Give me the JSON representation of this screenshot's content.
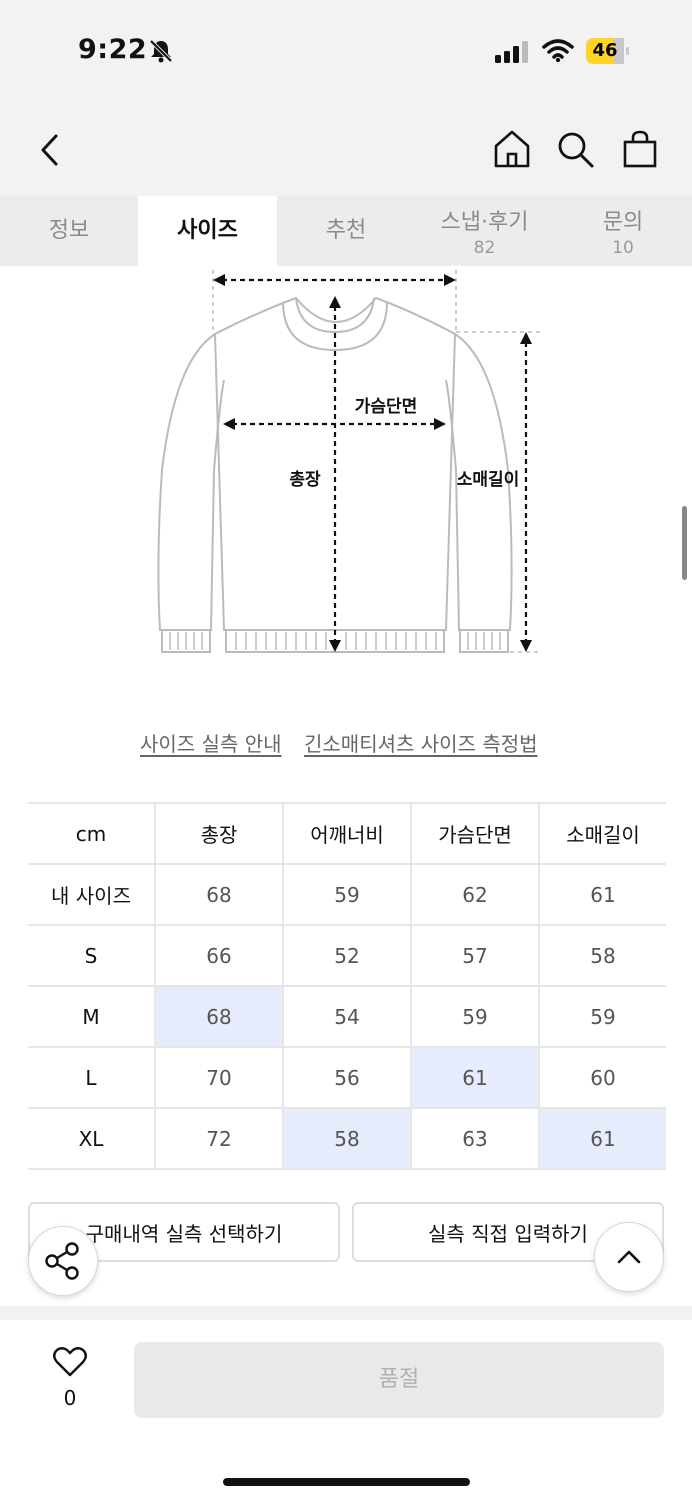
{
  "status": {
    "time": "9:22",
    "battery": "46"
  },
  "tabs": [
    {
      "label": "정보",
      "count": ""
    },
    {
      "label": "사이즈",
      "count": ""
    },
    {
      "label": "추천",
      "count": ""
    },
    {
      "label": "스냅·후기",
      "count": "82"
    },
    {
      "label": "문의",
      "count": "10"
    }
  ],
  "active_tab": "사이즈",
  "diagram": {
    "chest_label": "가슴단면",
    "length_label": "총장",
    "sleeve_label": "소매길이"
  },
  "links": {
    "guide": "사이즈 실측 안내",
    "method": "긴소매티셔츠 사이즈 측정법"
  },
  "size_table": {
    "headers": [
      "cm",
      "총장",
      "어깨너비",
      "가슴단면",
      "소매길이"
    ],
    "rows": [
      [
        "내 사이즈",
        "68",
        "59",
        "62",
        "61"
      ],
      [
        "S",
        "66",
        "52",
        "57",
        "58"
      ],
      [
        "M",
        "68",
        "54",
        "59",
        "59"
      ],
      [
        "L",
        "70",
        "56",
        "61",
        "60"
      ],
      [
        "XL",
        "72",
        "58",
        "63",
        "61"
      ]
    ],
    "highlight_color": "#e6ecfc"
  },
  "buttons": {
    "purchase_history": "구매내역 실측 선택하기",
    "manual_input": "실측 직접 입력하기"
  },
  "bottom": {
    "like_count": "0",
    "buy_label": "품절"
  },
  "icons": [
    "back-icon",
    "home-icon",
    "search-icon",
    "shopping-bag-icon",
    "share-icon",
    "chevron-up-icon",
    "heart-icon",
    "bell-slash-icon"
  ]
}
